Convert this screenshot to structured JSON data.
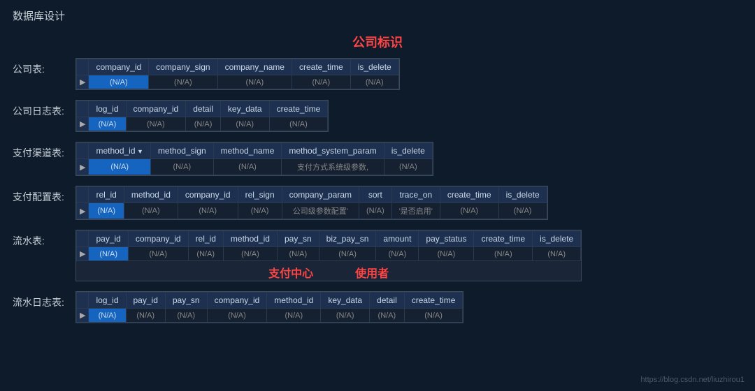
{
  "page": {
    "title": "数据库设计",
    "center_label": "公司标识",
    "watermark": "https://blog.csdn.net/liuzhirou1"
  },
  "tables": [
    {
      "label": "公司表:",
      "columns": [
        "company_id",
        "company_sign",
        "company_name",
        "create_time",
        "is_delete"
      ],
      "row": [
        "(N/A)",
        "(N/A)",
        "(N/A)",
        "(N/A)",
        "(N/A)"
      ],
      "selected_col": 0,
      "hint": null
    },
    {
      "label": "公司日志表:",
      "columns": [
        "log_id",
        "company_id",
        "detail",
        "key_data",
        "create_time"
      ],
      "row": [
        "(N/A)",
        "(N/A)",
        "(N/A)",
        "(N/A)",
        "(N/A)"
      ],
      "selected_col": 0,
      "hint": null
    },
    {
      "label": "支付渠道表:",
      "columns": [
        "method_id",
        "method_sign",
        "method_name",
        "method_system_param",
        "is_delete"
      ],
      "row": [
        "(N/A)",
        "(N/A)",
        "(N/A)",
        "支付方式系统级参数,",
        "(N/A)"
      ],
      "selected_col": 0,
      "hint": null,
      "arrow_col": 0
    },
    {
      "label": "支付配置表:",
      "columns": [
        "rel_id",
        "method_id",
        "company_id",
        "rel_sign",
        "company_param",
        "sort",
        "trace_on",
        "create_time",
        "is_delete"
      ],
      "row": [
        "(N/A)",
        "(N/A)",
        "(N/A)",
        "(N/A)",
        "公司级参数配置'",
        "(N/A)",
        "'是否启用'",
        "(N/A)",
        "(N/A)"
      ],
      "selected_col": 0,
      "hint": null
    },
    {
      "label": "流水表:",
      "columns": [
        "pay_id",
        "company_id",
        "rel_id",
        "method_id",
        "pay_sn",
        "biz_pay_sn",
        "amount",
        "pay_status",
        "create_time",
        "is_delete"
      ],
      "row": [
        "(N/A)",
        "(N/A)",
        "(N/A)",
        "(N/A)",
        "(N/A)",
        "(N/A)",
        "(N/A)",
        "(N/A)",
        "(N/A)",
        "(N/A)"
      ],
      "selected_col": 0,
      "center_labels": [
        "支付中心",
        "使用者"
      ]
    },
    {
      "label": "流水日志表:",
      "columns": [
        "log_id",
        "pay_id",
        "pay_sn",
        "company_id",
        "method_id",
        "key_data",
        "detail",
        "create_time"
      ],
      "row": [
        "(N/A)",
        "(N/A)",
        "(N/A)",
        "(N/A)",
        "(N/A)",
        "(N/A)",
        "(N/A)",
        "(N/A)"
      ],
      "selected_col": 0,
      "hint": null
    }
  ]
}
